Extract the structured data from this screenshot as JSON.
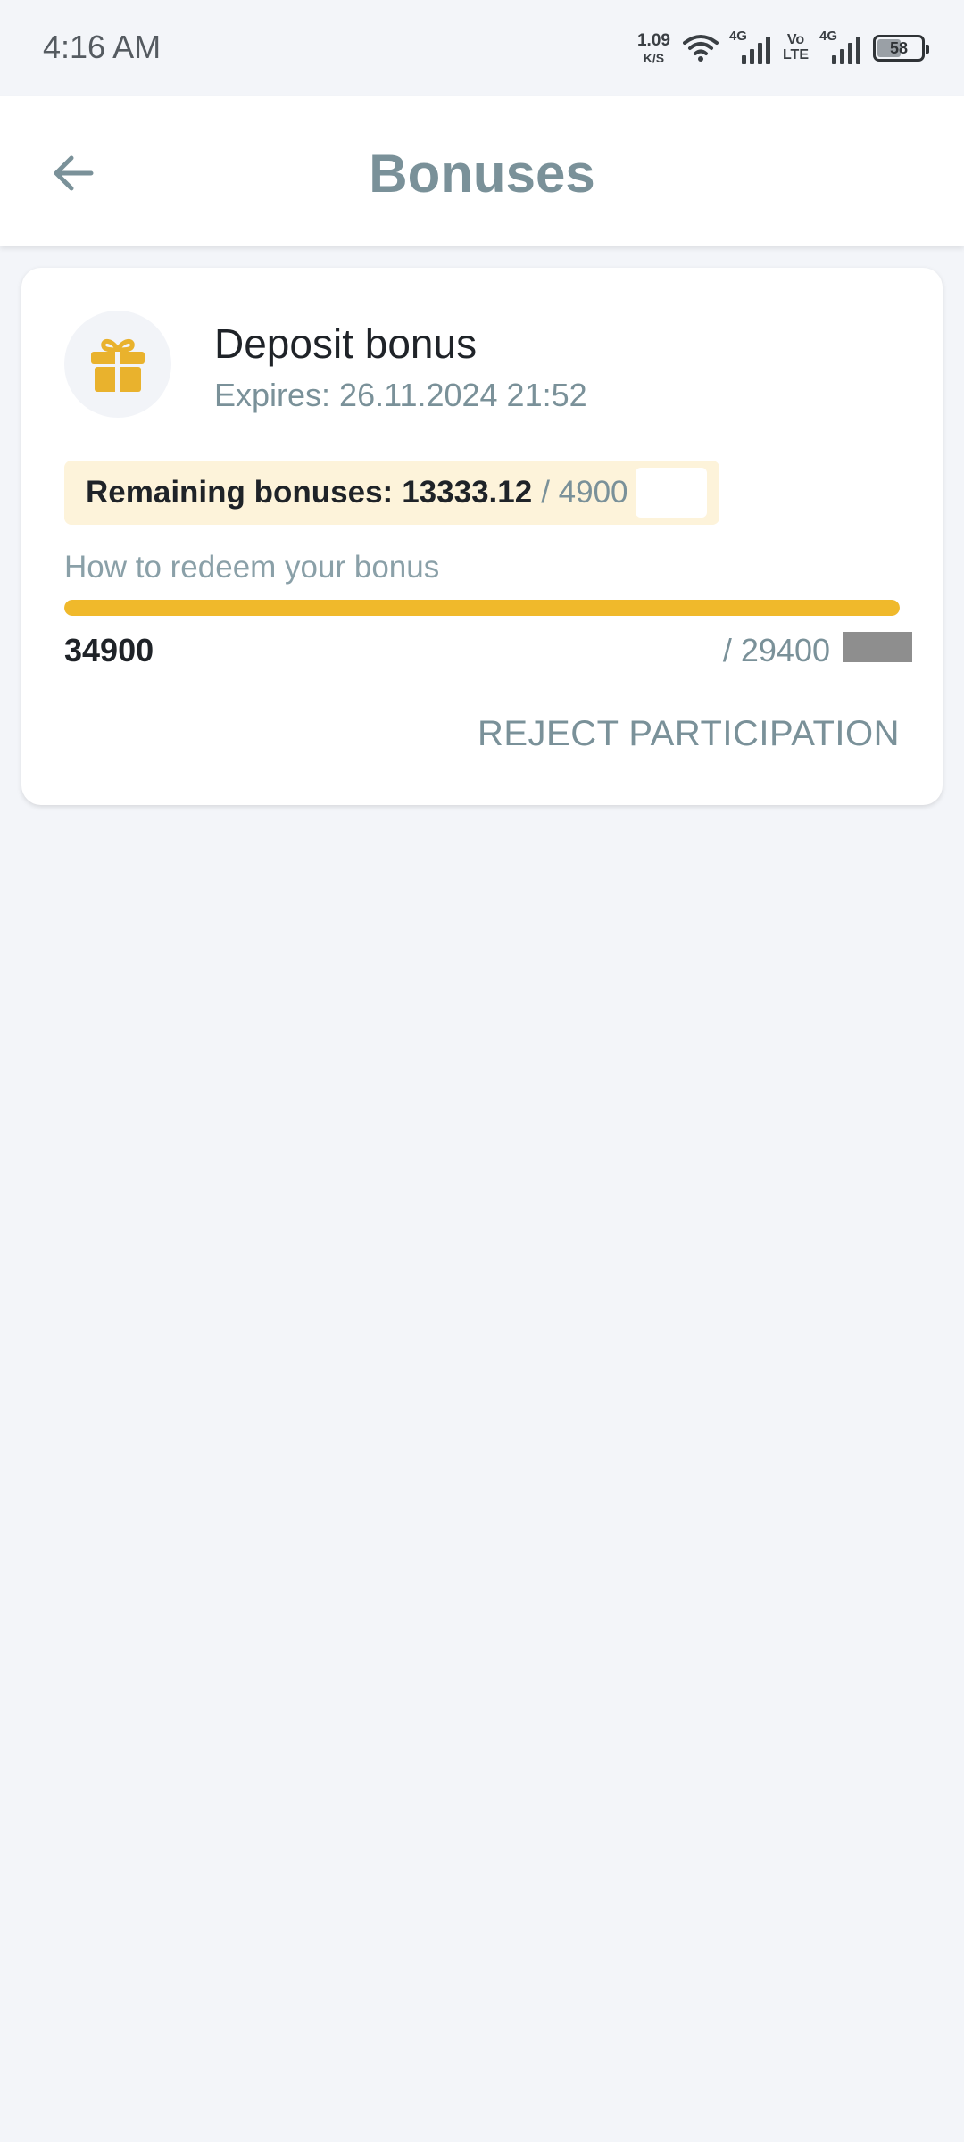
{
  "status_bar": {
    "time": "4:16 AM",
    "net_speed_value": "1.09",
    "net_speed_unit": "K/S",
    "signal_1_label": "4G",
    "volte_top": "Vo",
    "volte_bottom": "LTE",
    "signal_2_label": "4G",
    "battery_percent": "58",
    "battery_level": 0.58
  },
  "header": {
    "title": "Bonuses",
    "back_icon": "arrow-left-icon"
  },
  "bonus_card": {
    "icon": "gift-icon",
    "title": "Deposit bonus",
    "expires": "Expires: 26.11.2024 21:52",
    "remaining_label": "Remaining bonuses:",
    "remaining_value": "13333.12",
    "remaining_total": "/ 4900",
    "redeem_link": "How to redeem your bonus",
    "progress_current": "34900",
    "progress_target": "/ 29400",
    "progress_fraction": 1.0,
    "reject_label": "REJECT PARTICIPATION"
  },
  "colors": {
    "accent": "#f0b92b",
    "muted_text": "#7a9199",
    "background": "#f3f5f9"
  }
}
